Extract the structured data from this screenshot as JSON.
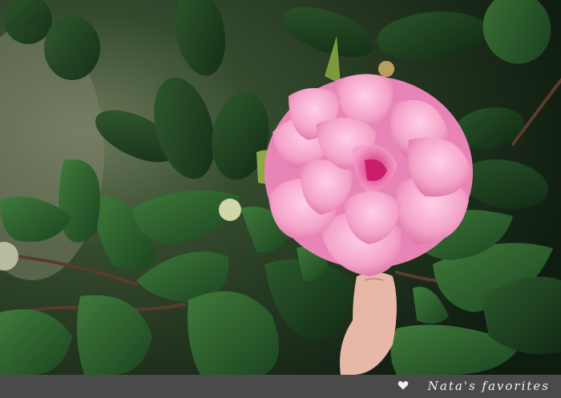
{
  "photo": {
    "subject": "pink camellia flower among dark green leaves",
    "icons": [
      "heart-icon"
    ]
  },
  "footer": {
    "watermark": "Nata's favorites",
    "colors": {
      "bar": "#4a4a4a",
      "text": "#f1f1f1"
    }
  }
}
